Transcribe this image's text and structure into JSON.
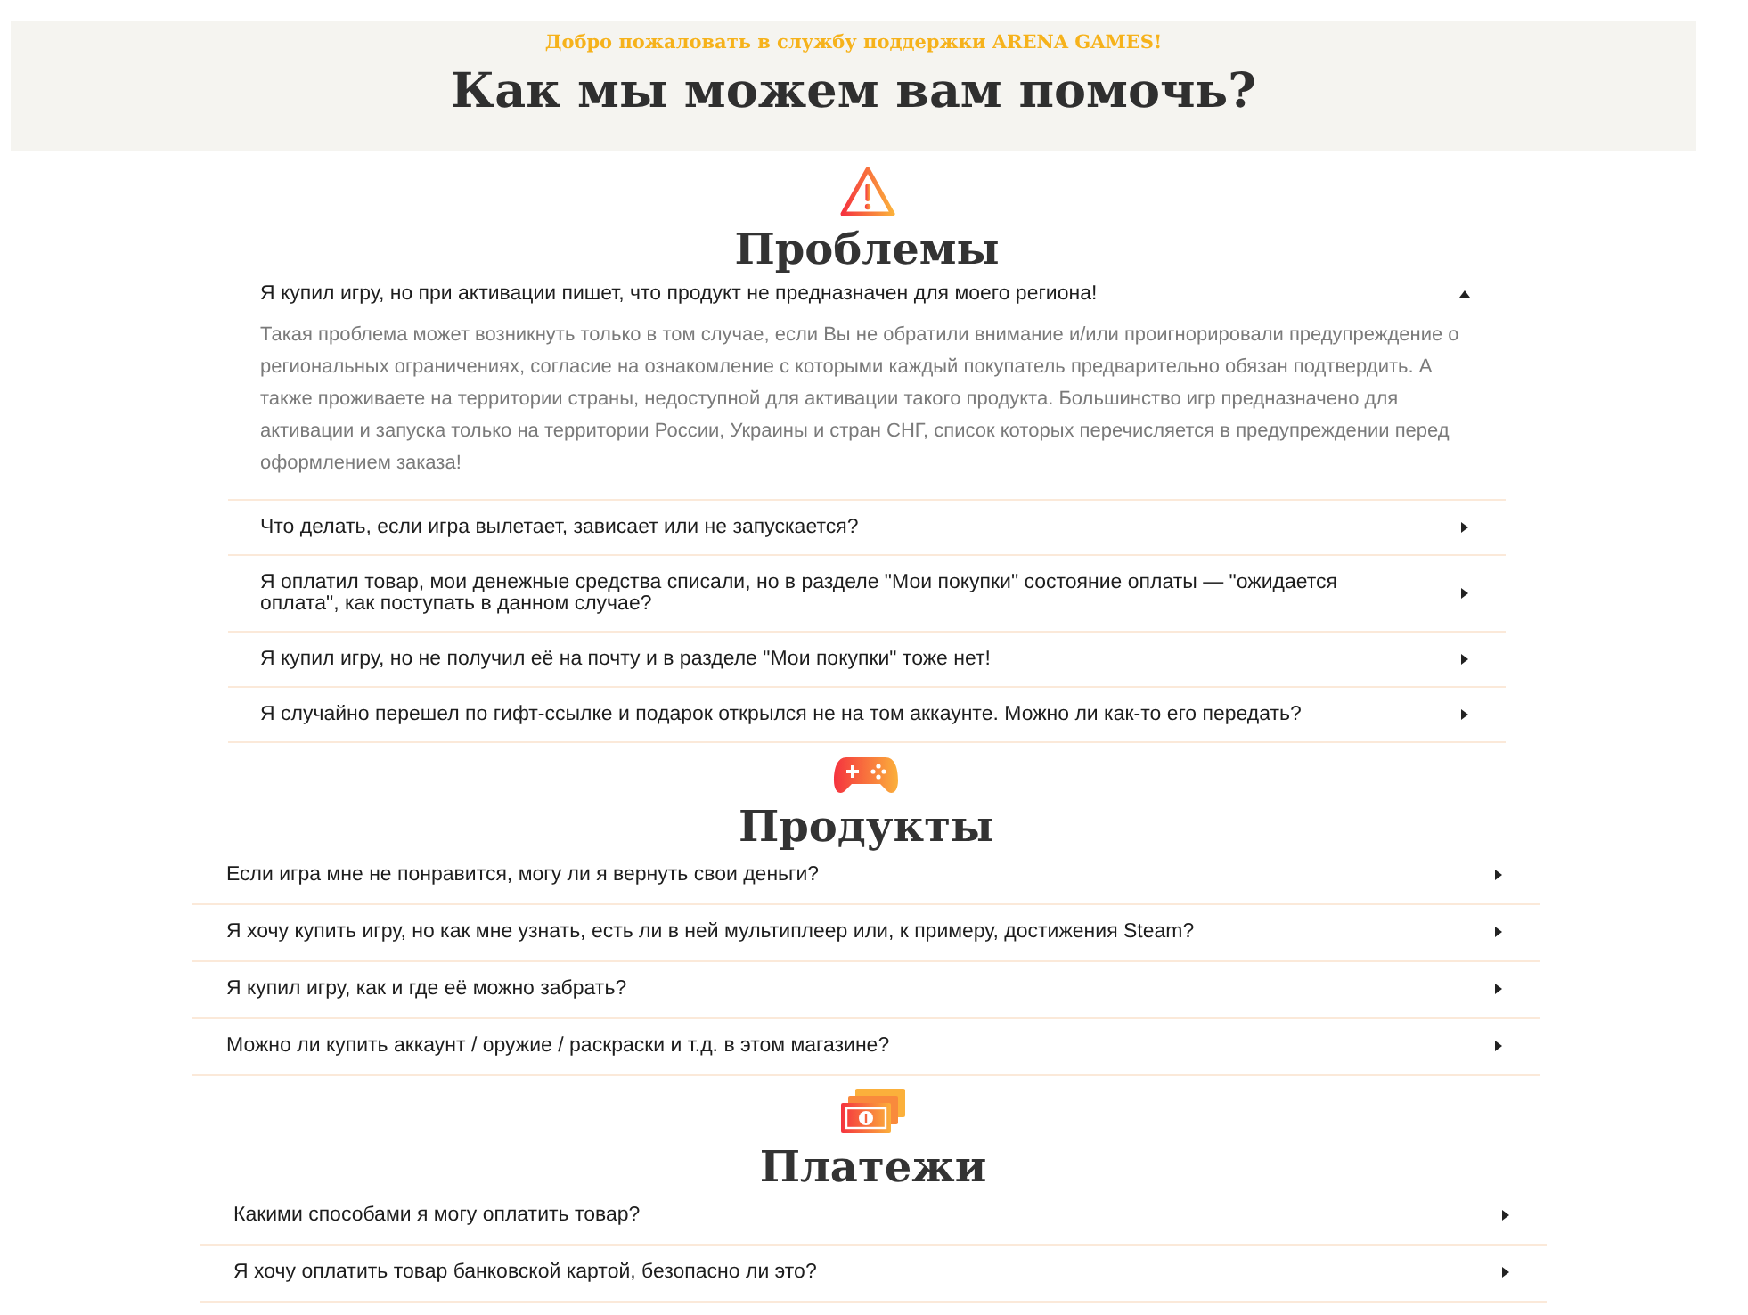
{
  "header": {
    "welcome": "Добро пожаловать в службу поддержки ARENA GAMES!",
    "title": "Как мы можем вам помочь?"
  },
  "sections": [
    {
      "kind": "warning",
      "title": "Проблемы",
      "questions": [
        {
          "question": "Я купил игру, но при активации пишет, что продукт не предназначен для моего региона!",
          "expanded": true,
          "answer": "Такая проблема может возникнуть только в том случае, если Вы не обратили внимание и/или проигнорировали предупреждение о региональных ограничениях, согласие на ознакомление с которыми каждый покупатель предварительно обязан подтвердить. А также проживаете на территории страны, недоступной для активации такого продукта. Большинство игр предназначено для активации и запуска только на территории России, Украины и стран СНГ, список которых перечисляется в предупреждении перед оформлением заказа!"
        },
        {
          "question": "Что делать, если игра вылетает, зависает или не запускается?",
          "expanded": false
        },
        {
          "question": "Я оплатил товар, мои денежные средства списали, но в разделе \"Мои покупки\" состояние оплаты — \"ожидается оплата\", как поступать в данном случае?",
          "expanded": false
        },
        {
          "question": "Я купил игру, но не получил её на почту и в разделе \"Мои покупки\" тоже нет!",
          "expanded": false
        },
        {
          "question": "Я случайно перешел по гифт-ссылке и подарок открылся не на том аккаунте. Можно ли как-то его передать?",
          "expanded": false
        }
      ]
    },
    {
      "kind": "gamepad",
      "title": "Продукты",
      "questions": [
        {
          "question": "Если игра мне не понравится, могу ли я вернуть свои деньги?",
          "expanded": false
        },
        {
          "question": "Я хочу купить игру, но как мне узнать, есть ли в ней мультиплеер или, к примеру, достижения Steam?",
          "expanded": false
        },
        {
          "question": "Я купил игру, как и где её можно забрать?",
          "expanded": false
        },
        {
          "question": "Можно ли купить аккаунт / оружие / раскраски и т.д. в этом магазине?",
          "expanded": false
        }
      ]
    },
    {
      "kind": "money",
      "title": "Платежи",
      "questions": [
        {
          "question": "Какими способами я могу оплатить товар?",
          "expanded": false
        },
        {
          "question": "Я хочу оплатить товар банковской картой, безопасно ли это?",
          "expanded": false
        }
      ]
    }
  ]
}
